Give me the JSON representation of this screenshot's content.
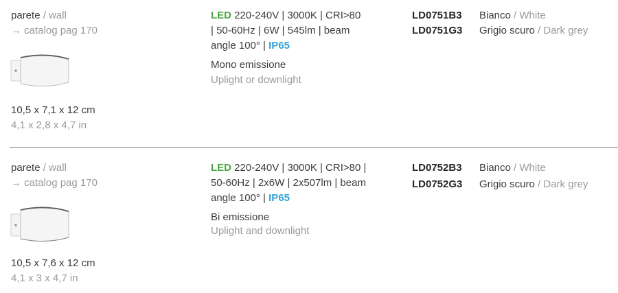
{
  "products": [
    {
      "mount_it": "parete",
      "mount_sep": " / ",
      "mount_en": "wall",
      "catalog": "→ catalog pag 170",
      "dim_cm": "10,5 x 7,1 x 12 cm",
      "dim_in": "4,1 x 2,8 x 4,7 in",
      "led_label": "LED",
      "spec_line1": " 220-240V | 3000K | CRI>80",
      "spec_line2": "| 50-60Hz | 6W | 545lm | beam",
      "spec_line3": "angle 100° | ",
      "ip": "IP65",
      "emission_it": "Mono emissione",
      "emission_en": "Uplight or downlight",
      "variants": [
        {
          "code": "LD0751B3",
          "color_it": "Bianco",
          "sep": " / ",
          "color_en": "White"
        },
        {
          "code": "LD0751G3",
          "color_it": "Grigio scuro",
          "sep": " / ",
          "color_en": "Dark grey"
        }
      ]
    },
    {
      "mount_it": "parete",
      "mount_sep": " / ",
      "mount_en": "wall",
      "catalog": "→ catalog pag 170",
      "dim_cm": "10,5 x 7,6 x 12 cm",
      "dim_in": "4,1 x 3 x 4,7 in",
      "led_label": "LED",
      "spec_line1": " 220-240V | 3000K | CRI>80 |",
      "spec_line2": "50-60Hz | 2x6W | 2x507lm | beam",
      "spec_line3": "angle 100° | ",
      "ip": "IP65",
      "emission_it": "Bi emissione",
      "emission_en": "Uplight and downlight",
      "variants": [
        {
          "code": "LD0752B3",
          "color_it": "Bianco",
          "sep": " / ",
          "color_en": "White"
        },
        {
          "code": "LD0752G3",
          "color_it": "Grigio scuro",
          "sep": " / ",
          "color_en": "Dark grey"
        }
      ]
    }
  ],
  "colors": {
    "text": "#3c3c3c",
    "muted": "#9a9a9a",
    "led_green": "#4aa640",
    "ip_blue": "#2ea3d6",
    "divider": "#7a7a7a"
  },
  "icons": {
    "lamp_drawing": "wall-lamp-illustration"
  }
}
